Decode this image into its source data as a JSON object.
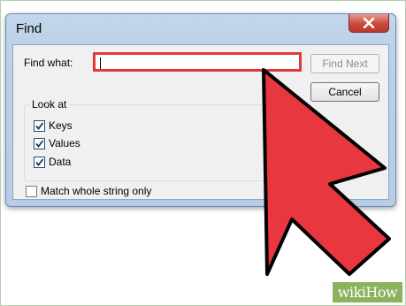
{
  "dialog": {
    "title": "Find",
    "find_what_label": "Find what:",
    "find_what_value": "",
    "find_next_label": "Find Next",
    "cancel_label": "Cancel",
    "look_at_label": "Look at",
    "options": [
      {
        "label": "Keys",
        "checked": true
      },
      {
        "label": "Values",
        "checked": true
      },
      {
        "label": "Data",
        "checked": true
      }
    ],
    "match_whole_string": {
      "label": "Match whole string only",
      "checked": false
    }
  },
  "annotation": {
    "arrow_color": "#e8373e",
    "highlight_color": "#e0383d"
  },
  "watermark": {
    "text": "wikiHow",
    "background": "#8ab35e"
  },
  "icons": [
    "close-icon",
    "checkmark-icon",
    "arrow-pointer-icon"
  ]
}
